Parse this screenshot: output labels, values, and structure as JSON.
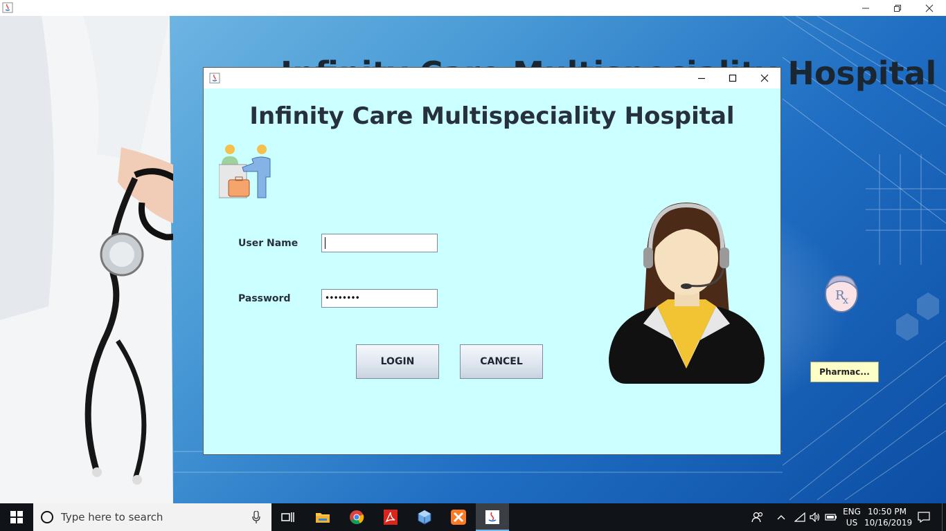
{
  "main_window": {
    "background_title": "Infinity Care Multispeciality Hospital",
    "pharmacy_button": "Pharmac..."
  },
  "login_dialog": {
    "title": "Infinity Care Multispeciality Hospital",
    "username_label": "User Name",
    "username_value": "",
    "password_label": "Password",
    "password_value": "••••••••",
    "login_button": "LOGIN",
    "cancel_button": "CANCEL"
  },
  "taskbar": {
    "search_placeholder": "Type here to search",
    "apps": [
      "task-view",
      "file-explorer",
      "chrome",
      "acrobat",
      "virtualbox",
      "xampp",
      "java"
    ],
    "language_line1": "ENG",
    "language_line2": "US",
    "time": "10:50 PM",
    "date": "10/16/2019"
  },
  "colors": {
    "dialog_bg": "#ccffff",
    "title_text": "#26313d",
    "pharmacy_btn_bg": "#ffffc8",
    "taskbar_bg": "#101317"
  }
}
